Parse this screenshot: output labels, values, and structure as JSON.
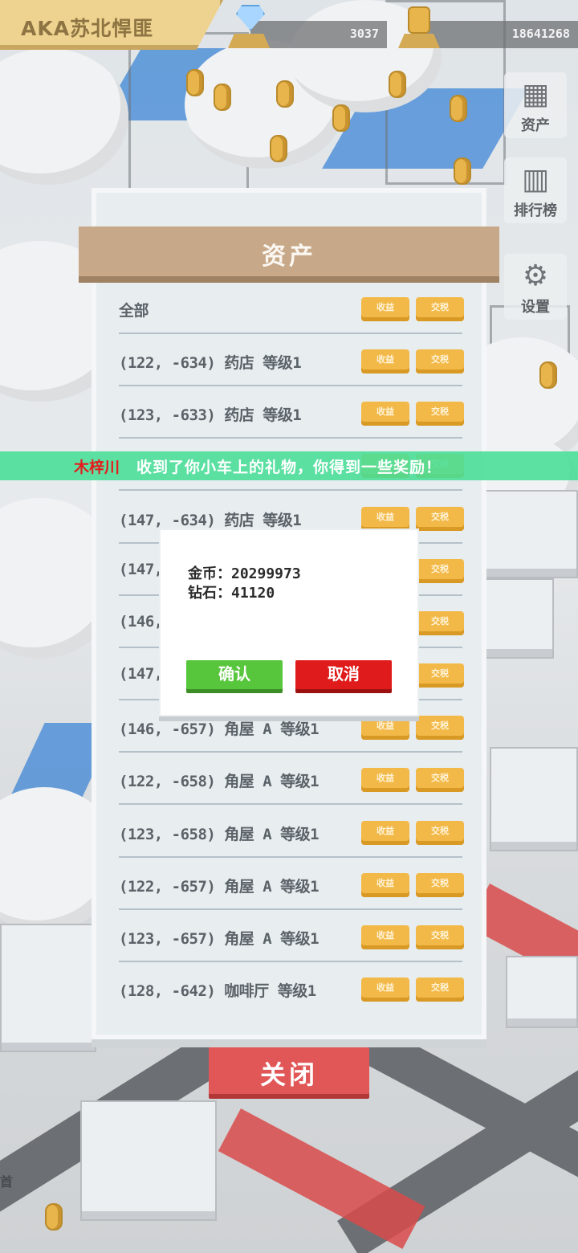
{
  "hud": {
    "game_title": "AKA苏北悍匪",
    "diamonds": "3037",
    "gold": "18641268"
  },
  "side_menu": [
    {
      "label": "资产",
      "icon": "building-icon"
    },
    {
      "label": "排行榜",
      "icon": "leaderboard-icon"
    },
    {
      "label": "设置",
      "icon": "gear-icon"
    }
  ],
  "asset_panel": {
    "title": "资产",
    "all_label": "全部",
    "income_label": "收益",
    "tax_label": "交税",
    "rows": [
      "(122, -634) 药店 等级1",
      "(123, -633) 药店 等级1",
      "",
      "(147, -634) 药店 等级1",
      "(147,",
      "(146,",
      "(147,",
      "(146, -657) 角屋 A 等级1",
      "(122, -658) 角屋 A 等级1",
      "(123, -658) 角屋 A 等级1",
      "(122, -657) 角屋 A 等级1",
      "(123, -657) 角屋 A 等级1",
      "(128, -642) 咖啡厅 等级1"
    ],
    "close_label": "关闭"
  },
  "banner": {
    "sender": "木梓川",
    "message": "收到了你小车上的礼物，你得到一些奖励！"
  },
  "dialog": {
    "gold_line": "金币：20299973",
    "diamond_line": "钻石：41120",
    "confirm_label": "确认",
    "cancel_label": "取消"
  },
  "edge_text": "首",
  "colors": {
    "panel_header": "#c7a888",
    "pill": "#f2b949",
    "close_button": "#e15656",
    "banner": "#47de96",
    "confirm": "#58c63d",
    "cancel": "#e01b1b"
  }
}
